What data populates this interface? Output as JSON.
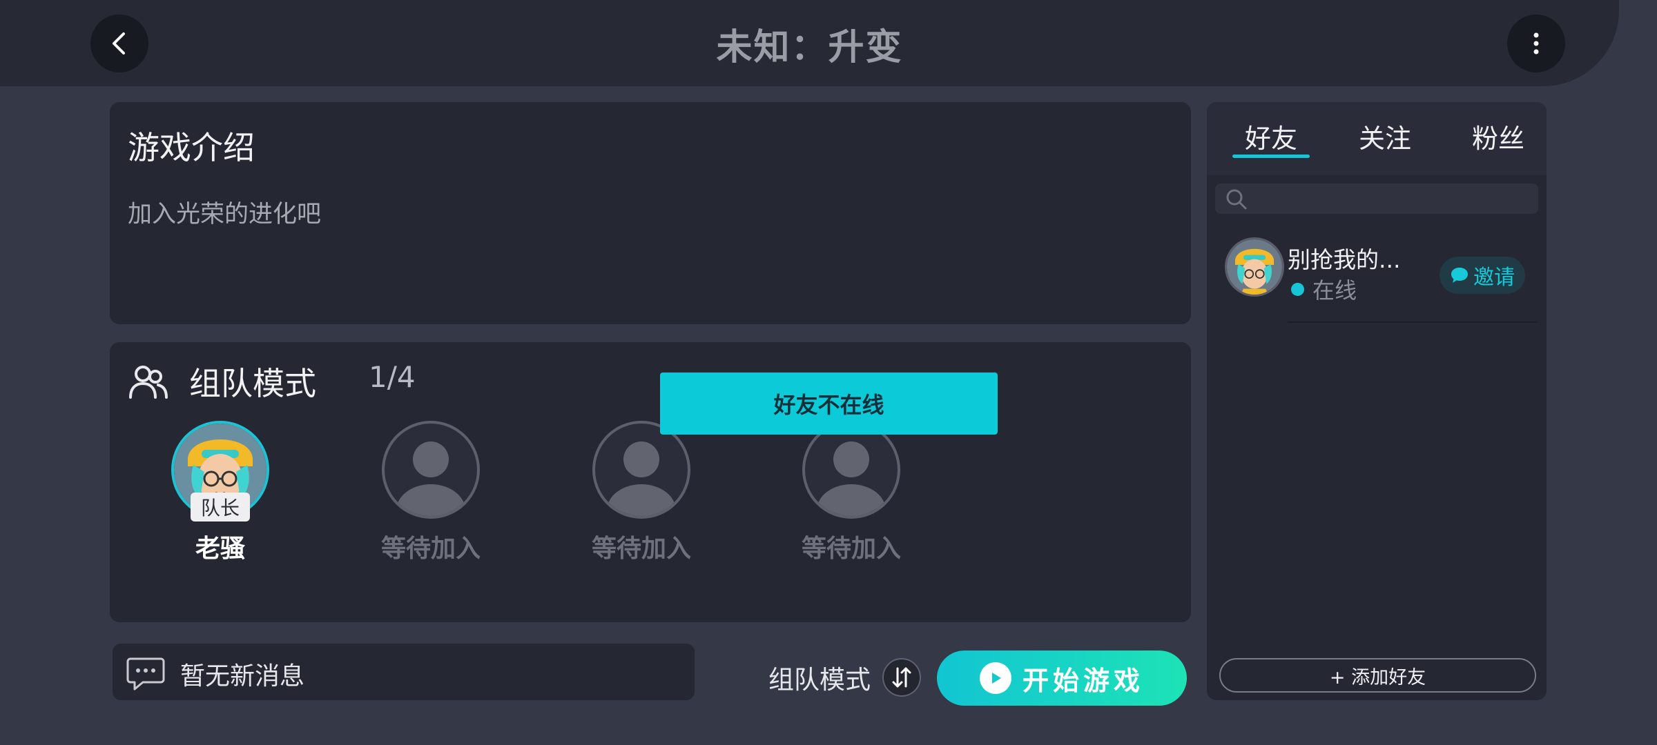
{
  "header": {
    "title": "未知：升变",
    "back_icon": "chevron-left-icon",
    "more_icon": "vertical-dots-icon"
  },
  "intro": {
    "title": "游戏介绍",
    "description": "加入光荣的进化吧"
  },
  "team": {
    "title": "组队模式",
    "count": "1/4",
    "icon": "people-icon",
    "slots": [
      {
        "name": "老骚",
        "badge": "队长",
        "filled": true
      },
      {
        "name": "等待加入",
        "filled": false
      },
      {
        "name": "等待加入",
        "filled": false
      },
      {
        "name": "等待加入",
        "filled": false
      }
    ]
  },
  "toast": {
    "text": "好友不在线"
  },
  "messages": {
    "text": "暂无新消息",
    "icon": "chat-bubble-icon"
  },
  "controls": {
    "mode_label": "组队模式",
    "switch_icon": "swap-arrows-icon",
    "start_label": "开始游戏",
    "play_icon": "play-icon"
  },
  "friends": {
    "tabs": [
      "好友",
      "关注",
      "粉丝"
    ],
    "active_tab": 0,
    "search_icon": "search-icon",
    "list": [
      {
        "name": "别抢我的...",
        "status": "在线",
        "invite_label": "邀请"
      }
    ],
    "add_label": "+ 添加好友"
  },
  "colors": {
    "background": "#343847",
    "panel": "#252733",
    "accent": "#0ccad8",
    "start_gradient_end": "#1de3b6"
  }
}
